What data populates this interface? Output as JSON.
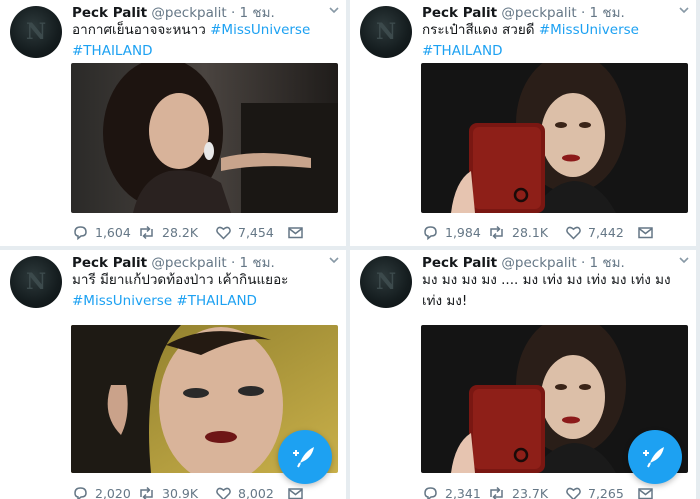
{
  "tweets": [
    {
      "name": "Peck Palit",
      "handle": "@peckpalit",
      "dot": "·",
      "time": "1 ชม.",
      "text": "อากาศเย็นอาจจะหนาว",
      "tags": [
        "#MissUniverse",
        "#THAILAND"
      ],
      "stats": {
        "replies": "1,604",
        "retweets": "28.2K",
        "likes": "7,454"
      }
    },
    {
      "name": "Peck Palit",
      "handle": "@peckpalit",
      "dot": "·",
      "time": "1 ชม.",
      "text": "กระเป๋าสีแดง สวยดี",
      "tags": [
        "#MissUniverse",
        "#THAILAND"
      ],
      "stats": {
        "replies": "1,984",
        "retweets": "28.1K",
        "likes": "7,442"
      }
    },
    {
      "name": "Peck Palit",
      "handle": "@peckpalit",
      "dot": "·",
      "time": "1 ชม.",
      "text": "มารี มียาแก้ปวดท้องป่าว เค้ากินแยอะ",
      "tags": [
        "#MissUniverse",
        "#THAILAND"
      ],
      "stats": {
        "replies": "2,020",
        "retweets": "30.9K",
        "likes": "8,002"
      }
    },
    {
      "name": "Peck Palit",
      "handle": "@peckpalit",
      "dot": "·",
      "time": "1 ชม.",
      "text": "มง มง มง มง .... มง เท่ง มง เท่ง มง เท่ง มง เท่ง มง!",
      "tags": [],
      "stats": {
        "replies": "2,341",
        "retweets": "23.7K",
        "likes": "7,265"
      }
    }
  ],
  "icons": {
    "avatar": "profile-avatar",
    "menu": "chevron-down-icon",
    "reply": "reply-icon",
    "retweet": "retweet-icon",
    "like": "heart-icon",
    "message": "envelope-icon",
    "compose": "compose-tweet-icon"
  },
  "colors": {
    "link": "#1da1f2",
    "muted": "#657786",
    "fab": "#1da1f2"
  }
}
